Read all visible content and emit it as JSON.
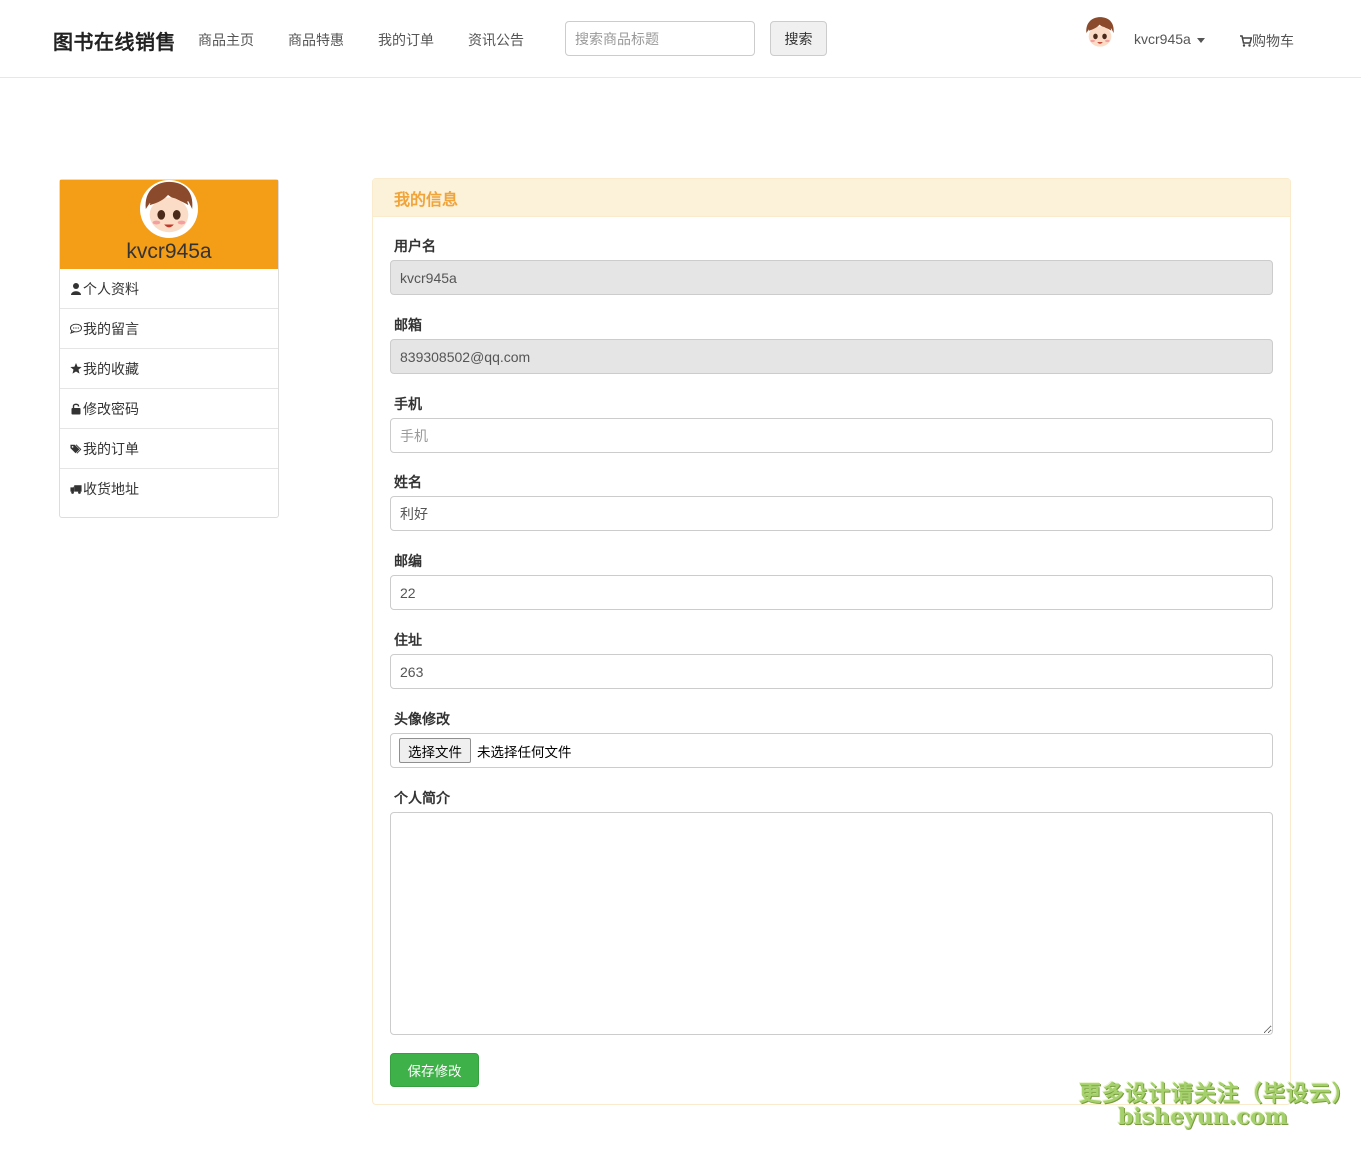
{
  "navbar": {
    "brand": "图书在线销售",
    "links": [
      "商品主页",
      "商品特惠",
      "我的订单",
      "资讯公告"
    ],
    "search_placeholder": "搜索商品标题",
    "search_button": "搜索",
    "username": "kvcr945a",
    "cart": "购物车"
  },
  "sidebar": {
    "username": "kvcr945a",
    "items": [
      {
        "icon": "user-icon",
        "label": "个人资料"
      },
      {
        "icon": "comment-icon",
        "label": "我的留言"
      },
      {
        "icon": "star-icon",
        "label": "我的收藏"
      },
      {
        "icon": "unlock-icon",
        "label": "修改密码"
      },
      {
        "icon": "tags-icon",
        "label": "我的订单"
      },
      {
        "icon": "truck-icon",
        "label": "收货地址"
      }
    ]
  },
  "panel": {
    "title": "我的信息",
    "fields": {
      "username": {
        "label": "用户名",
        "value": "kvcr945a"
      },
      "email": {
        "label": "邮箱",
        "value": "839308502@qq.com"
      },
      "phone": {
        "label": "手机",
        "value": "",
        "placeholder": "手机"
      },
      "name": {
        "label": "姓名",
        "value": "利好"
      },
      "zip": {
        "label": "邮编",
        "value": "22"
      },
      "address": {
        "label": "住址",
        "value": "263"
      },
      "avatar": {
        "label": "头像修改",
        "button": "选择文件",
        "status": "未选择任何文件"
      },
      "bio": {
        "label": "个人简介",
        "value": ""
      }
    },
    "save_button": "保存修改"
  },
  "watermark": {
    "line1": "更多设计请关注（毕设云）",
    "line2": "bisheyun.com"
  },
  "colors": {
    "sidebar_header": "#f49d17",
    "panel_title": "#f0a43a",
    "save_button": "#3fb149"
  }
}
